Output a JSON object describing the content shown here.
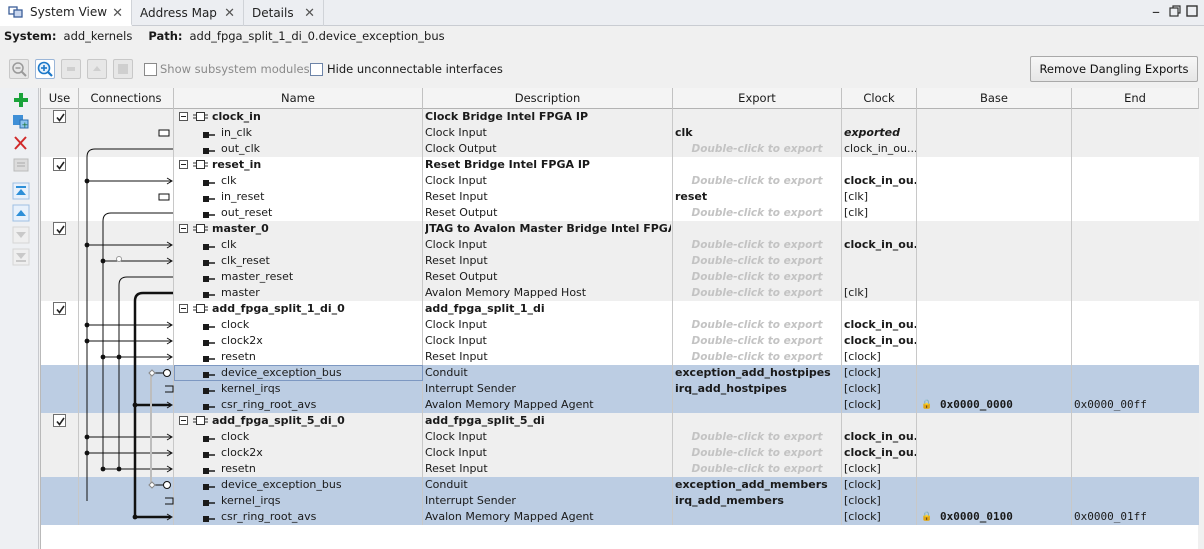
{
  "tabs": [
    {
      "label": "System View",
      "active": true
    },
    {
      "label": "Address Map",
      "active": false
    },
    {
      "label": "Details",
      "active": false
    }
  ],
  "info": {
    "system_label": "System:",
    "system_value": "add_kernels",
    "path_label": "Path:",
    "path_value": "add_fpga_split_1_di_0.device_exception_bus"
  },
  "toolbar": {
    "show_subsystem": "Show subsystem modules",
    "hide_unconnectable": "Hide unconnectable interfaces",
    "remove_dangling": "Remove Dangling Exports"
  },
  "columns": [
    "Use",
    "Connections",
    "Name",
    "Description",
    "Export",
    "Clock",
    "Base",
    "End"
  ],
  "export_placeholder": "Double-click to export",
  "rows": [
    {
      "parent": true,
      "name": "clock_in",
      "desc": "Clock Bridge Intel FPGA IP",
      "export": "",
      "clock": "",
      "group": 1
    },
    {
      "name": "in_clk",
      "desc": "Clock Input",
      "export": "clk",
      "clock": "exported",
      "clock_italic": true,
      "port": "in",
      "group": 1
    },
    {
      "name": "out_clk",
      "desc": "Clock Output",
      "export_ph": true,
      "clock": "clock_in_ou...",
      "port": "out",
      "group": 1
    },
    {
      "parent": true,
      "name": "reset_in",
      "desc": "Reset Bridge Intel FPGA IP",
      "clock": "",
      "group": 0
    },
    {
      "name": "clk",
      "desc": "Clock Input",
      "export_ph": true,
      "clock": "clock_in_ou...",
      "clock_bold": true,
      "port": "in",
      "group": 0
    },
    {
      "name": "in_reset",
      "desc": "Reset Input",
      "export": "reset",
      "clock": "[clk]",
      "port": "in",
      "group": 0
    },
    {
      "name": "out_reset",
      "desc": "Reset Output",
      "export_ph": true,
      "clock": "[clk]",
      "port": "out",
      "group": 0
    },
    {
      "parent": true,
      "name": "master_0",
      "desc": "JTAG to Avalon Master Bridge Intel FPGA IP",
      "clock": "",
      "group": 1
    },
    {
      "name": "clk",
      "desc": "Clock Input",
      "export_ph": true,
      "clock": "clock_in_ou...",
      "clock_bold": true,
      "port": "in",
      "group": 1
    },
    {
      "name": "clk_reset",
      "desc": "Reset Input",
      "export_ph": true,
      "clock": "",
      "port": "in",
      "group": 1
    },
    {
      "name": "master_reset",
      "desc": "Reset Output",
      "export_ph": true,
      "clock": "",
      "port": "out",
      "group": 1
    },
    {
      "name": "master",
      "desc": "Avalon Memory Mapped Host",
      "export_ph": true,
      "clock": "[clk]",
      "port": "out",
      "group": 1
    },
    {
      "parent": true,
      "name": "add_fpga_split_1_di_0",
      "desc": "add_fpga_split_1_di",
      "clock": "",
      "group": 0
    },
    {
      "name": "clock",
      "desc": "Clock Input",
      "export_ph": true,
      "clock": "clock_in_ou...",
      "clock_bold": true,
      "port": "in",
      "group": 0
    },
    {
      "name": "clock2x",
      "desc": "Clock Input",
      "export_ph": true,
      "clock": "clock_in_ou...",
      "clock_bold": true,
      "port": "in",
      "group": 0
    },
    {
      "name": "resetn",
      "desc": "Reset Input",
      "export_ph": true,
      "clock": "[clock]",
      "port": "in",
      "group": 0
    },
    {
      "name": "device_exception_bus",
      "desc": "Conduit",
      "export": "exception_add_hostpipes",
      "clock": "[clock]",
      "port": "conduit",
      "sel": true,
      "focus": true
    },
    {
      "name": "kernel_irqs",
      "desc": "Interrupt Sender",
      "export": "irq_add_hostpipes",
      "clock": "[clock]",
      "port": "out",
      "sel": true
    },
    {
      "name": "csr_ring_root_avs",
      "desc": "Avalon Memory Mapped Agent",
      "export": "",
      "clock": "[clock]",
      "base": "0x0000_0000",
      "end": "0x0000_00ff",
      "port": "in",
      "sel": true
    },
    {
      "parent": true,
      "name": "add_fpga_split_5_di_0",
      "desc": "add_fpga_split_5_di",
      "clock": "",
      "group": 1
    },
    {
      "name": "clock",
      "desc": "Clock Input",
      "export_ph": true,
      "clock": "clock_in_ou...",
      "clock_bold": true,
      "port": "in",
      "group": 1
    },
    {
      "name": "clock2x",
      "desc": "Clock Input",
      "export_ph": true,
      "clock": "clock_in_ou...",
      "clock_bold": true,
      "port": "in",
      "group": 1
    },
    {
      "name": "resetn",
      "desc": "Reset Input",
      "export_ph": true,
      "clock": "[clock]",
      "port": "in",
      "group": 1
    },
    {
      "name": "device_exception_bus",
      "desc": "Conduit",
      "export": "exception_add_members",
      "clock": "[clock]",
      "port": "conduit",
      "sel": true
    },
    {
      "name": "kernel_irqs",
      "desc": "Interrupt Sender",
      "export": "irq_add_members",
      "clock": "[clock]",
      "port": "out",
      "sel": true
    },
    {
      "name": "csr_ring_root_avs",
      "desc": "Avalon Memory Mapped Agent",
      "export": "",
      "clock": "[clock]",
      "base": "0x0000_0100",
      "end": "0x0000_01ff",
      "port": "in",
      "sel": true
    }
  ],
  "colors": {
    "selected_row": "#bccde3",
    "accent_green": "#1aa33a",
    "accent_blue": "#2d8fd8",
    "delete_red": "#d12a2a"
  },
  "icons": {
    "app": "system-view-icon",
    "zoom_out": "zoom-out-icon",
    "zoom_in": "zoom-in-icon",
    "add": "add-icon",
    "remove": "remove-icon"
  }
}
